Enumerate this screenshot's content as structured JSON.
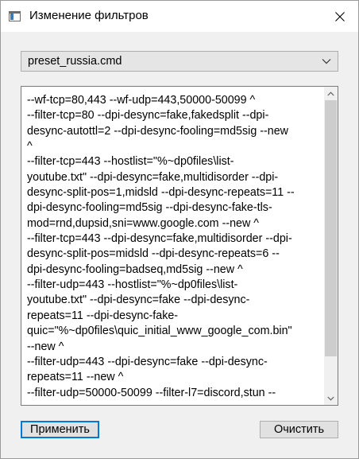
{
  "window": {
    "title": "Изменение фильтров",
    "close_label": "×"
  },
  "preset_select": {
    "value": "preset_russia.cmd"
  },
  "editor": {
    "lines": [
      "--wf-tcp=80,443 --wf-udp=443,50000-50099 ^",
      "--filter-tcp=80 --dpi-desync=fake,fakedsplit --dpi-",
      "desync-autottl=2 --dpi-desync-fooling=md5sig --new",
      "^",
      "--filter-tcp=443 --hostlist=\"%~dp0files\\list-",
      "youtube.txt\" --dpi-desync=fake,multidisorder --dpi-",
      "desync-split-pos=1,midsld --dpi-desync-repeats=11 --",
      "dpi-desync-fooling=md5sig --dpi-desync-fake-tls-",
      "mod=rnd,dupsid,sni=www.google.com --new ^",
      "--filter-tcp=443 --dpi-desync=fake,multidisorder --dpi-",
      "desync-split-pos=midsld --dpi-desync-repeats=6 --",
      "dpi-desync-fooling=badseq,md5sig --new ^",
      "--filter-udp=443 --hostlist=\"%~dp0files\\list-",
      "youtube.txt\" --dpi-desync=fake --dpi-desync-",
      "repeats=11 --dpi-desync-fake-",
      "quic=\"%~dp0files\\quic_initial_www_google_com.bin\"",
      "--new ^",
      "--filter-udp=443 --dpi-desync=fake --dpi-desync-",
      "repeats=11 --new ^",
      "--filter-udp=50000-50099 --filter-l7=discord,stun --"
    ]
  },
  "buttons": {
    "apply_label": "Применить",
    "clear_label": "Очистить"
  },
  "colors": {
    "accent": "#0078d7",
    "window_bg": "#f0f0f0",
    "scroll_thumb": "#cdcdcd"
  }
}
